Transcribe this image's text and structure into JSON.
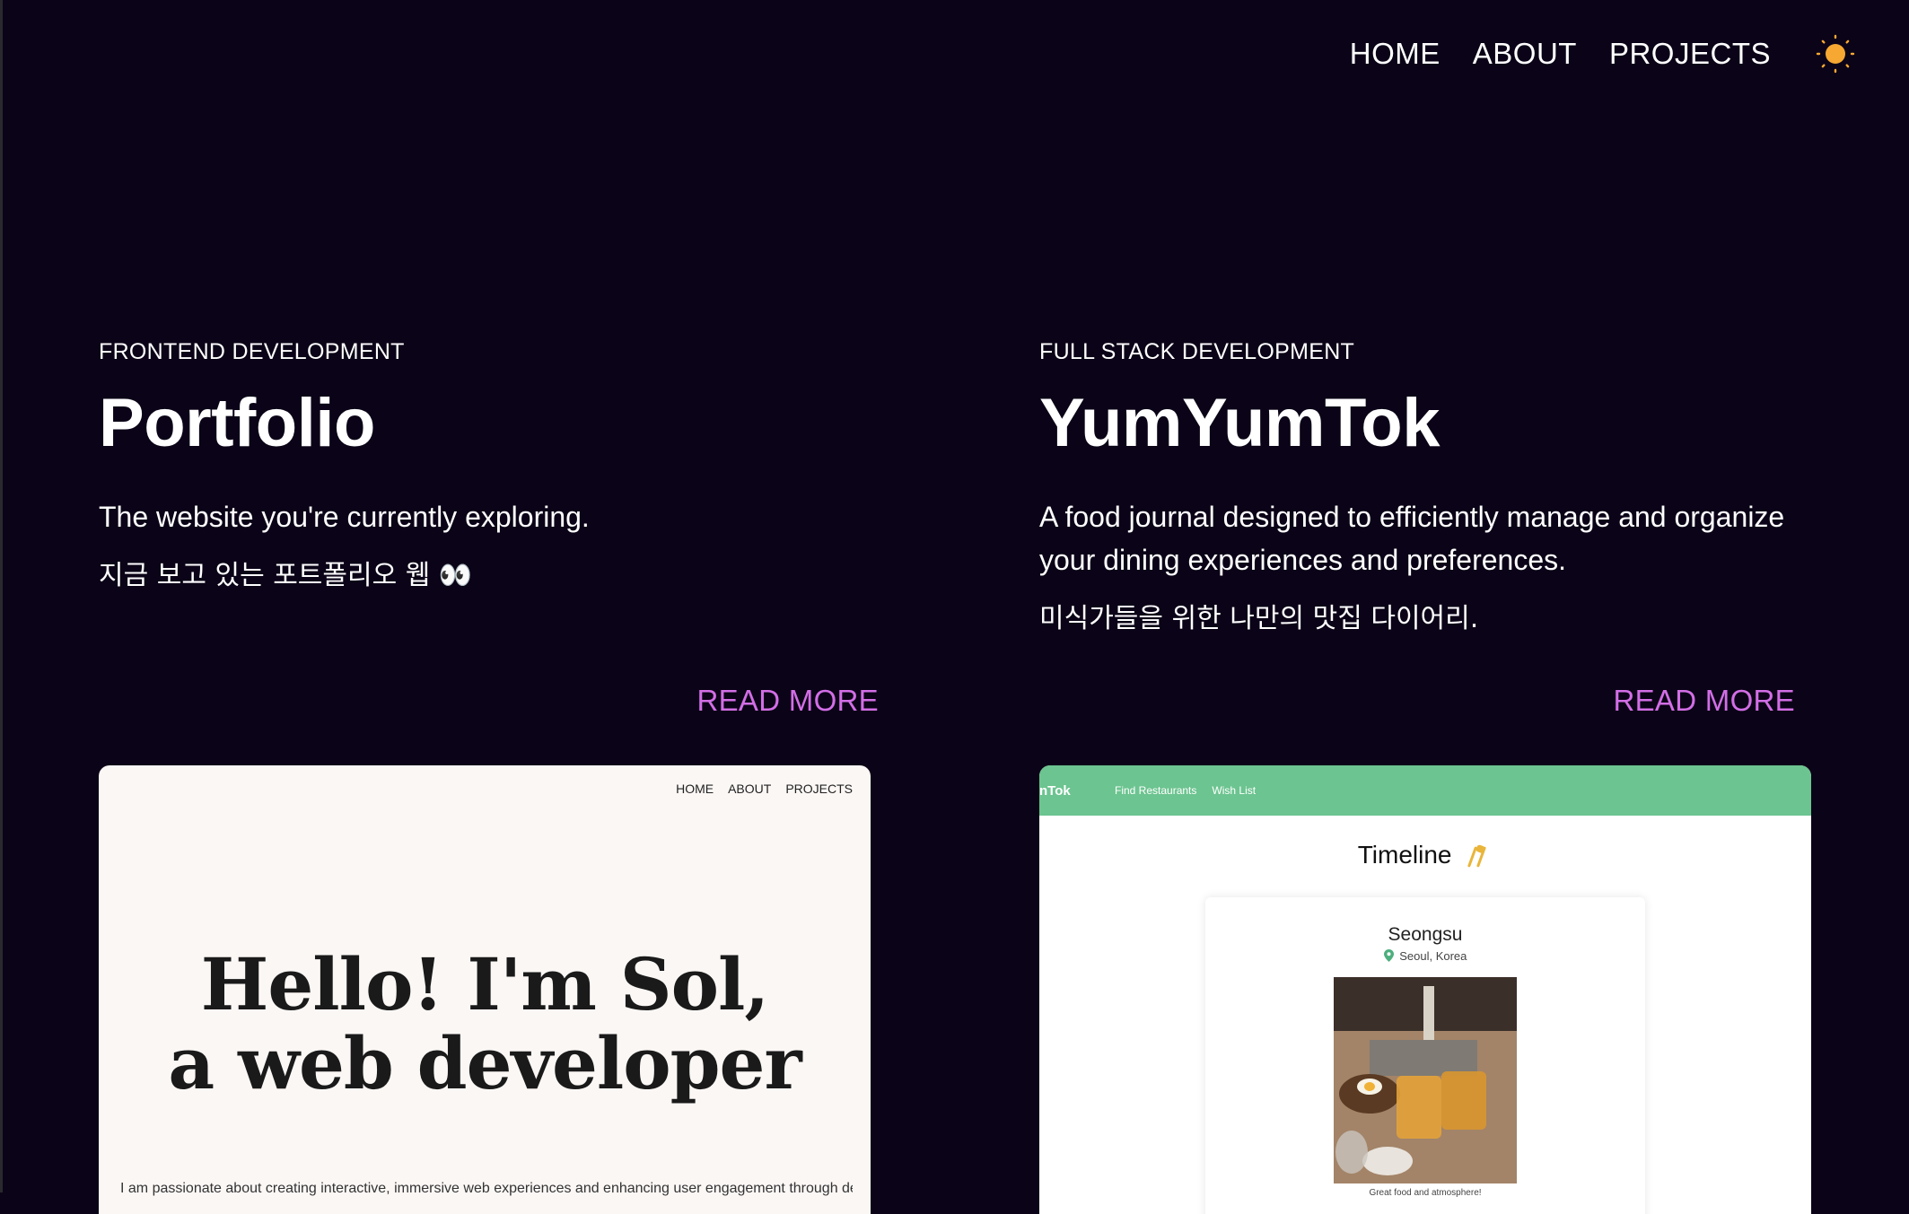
{
  "nav": {
    "items": [
      "HOME",
      "ABOUT",
      "PROJECTS"
    ],
    "theme_icon": "sun-icon"
  },
  "colors": {
    "background": "#0b0317",
    "accent": "#d26ee6",
    "sun": "#f6a832",
    "yumyum_green": "#6cc490"
  },
  "projects": [
    {
      "category": "FRONTEND DEVELOPMENT",
      "title": "Portfolio",
      "description": "The website you're currently exploring.",
      "description_ko": "지금 보고 있는 포트폴리오 웹 👀",
      "read_more": "READ MORE",
      "preview": {
        "nav": [
          "HOME",
          "ABOUT",
          "PROJECTS"
        ],
        "hero_line1": "Hello! I'm Sol,",
        "hero_line2": "a web developer",
        "footer_text": "I am passionate about creating interactive, immersive web experiences and enhancing user engagement through design"
      }
    },
    {
      "category": "FULL STACK DEVELOPMENT",
      "title": "YumYumTok",
      "description": "A food journal designed to efficiently manage and organize your dining experiences and preferences.",
      "description_ko": "미식가들을 위한 나만의 맛집 다이어리.",
      "read_more": "READ MORE",
      "preview": {
        "brand": "nTok",
        "links": [
          "Find Restaurants",
          "Wish List"
        ],
        "timeline_title": "Timeline",
        "place": "Seongsu",
        "location": "Seoul, Korea",
        "caption": "Great food and atmosphere!"
      }
    }
  ]
}
